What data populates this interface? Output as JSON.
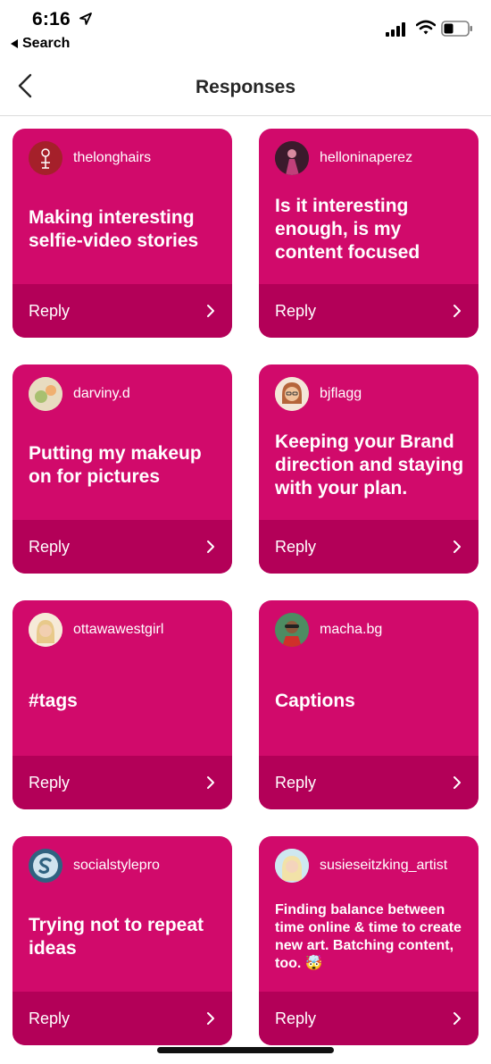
{
  "status": {
    "time": "6:16",
    "back_label": "Search"
  },
  "nav": {
    "title": "Responses"
  },
  "reply_label": "Reply",
  "cards": [
    {
      "username": "thelonghairs",
      "text": "Making interesting selfie-video stories",
      "avatar_color": "#a5202a"
    },
    {
      "username": "helloninaperez",
      "text": "Is it interesting enough, is my content focused",
      "avatar_color": "#5a2a3a"
    },
    {
      "username": "darviny.d",
      "text": "Putting my makeup on for pictures",
      "avatar_color": "#d9c9a0"
    },
    {
      "username": "bjflagg",
      "text": "Keeping your Brand direction and staying with your plan.",
      "avatar_color": "#e8b084"
    },
    {
      "username": "ottawawestgirl",
      "text": "#tags",
      "avatar_color": "#f0d3b0"
    },
    {
      "username": "macha.bg",
      "text": "Captions",
      "avatar_color": "#3a7a50"
    },
    {
      "username": "socialstylepro",
      "text": "Trying not to repeat ideas",
      "avatar_color": "#3c6f8f"
    },
    {
      "username": "susieseitzking_artist",
      "text": "Finding balance between time online & time to create new art.  Batching content, too. 🤯",
      "avatar_color": "#bfe0ea"
    }
  ],
  "colors": {
    "card": "#d10a6b",
    "reply_bar": "#b30058"
  }
}
